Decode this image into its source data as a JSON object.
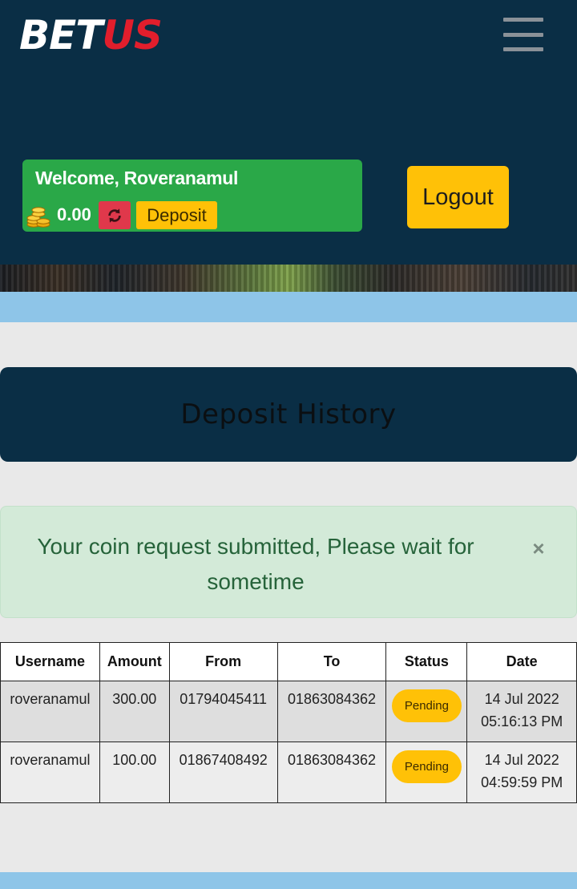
{
  "header": {
    "logo_left": "BE",
    "logo_t": "T",
    "logo_right": "US",
    "menu_icon": "hamburger-menu-icon"
  },
  "account": {
    "welcome": "Welcome, Roveranamul",
    "balance": "0.00",
    "coin_icon": "coins-icon",
    "refresh_icon": "refresh-icon",
    "deposit_label": "Deposit",
    "logout_label": "Logout"
  },
  "page": {
    "title": "Deposit History"
  },
  "alert": {
    "message": "Your coin request submitted, Please wait for sometime",
    "close_symbol": "×"
  },
  "table": {
    "headers": [
      "Username",
      "Amount",
      "From",
      "To",
      "Status",
      "Date"
    ],
    "rows": [
      {
        "username": "roveranamul",
        "amount": "300.00",
        "from": "01794045411",
        "to": "01863084362",
        "status": "Pending",
        "date": "14 Jul 2022",
        "time": "05:16:13 PM"
      },
      {
        "username": "roveranamul",
        "amount": "100.00",
        "from": "01867408492",
        "to": "01863084362",
        "status": "Pending",
        "date": "14 Jul 2022",
        "time": "04:59:59 PM"
      }
    ]
  },
  "colors": {
    "header_bg": "#0a2e45",
    "welcome_green": "#2aa848",
    "button_yellow": "#ffc107",
    "refresh_red": "#e0384b",
    "alert_bg": "#d3ead8",
    "strip_blue": "#8ec5e8",
    "logo_red": "#e11e2c"
  }
}
